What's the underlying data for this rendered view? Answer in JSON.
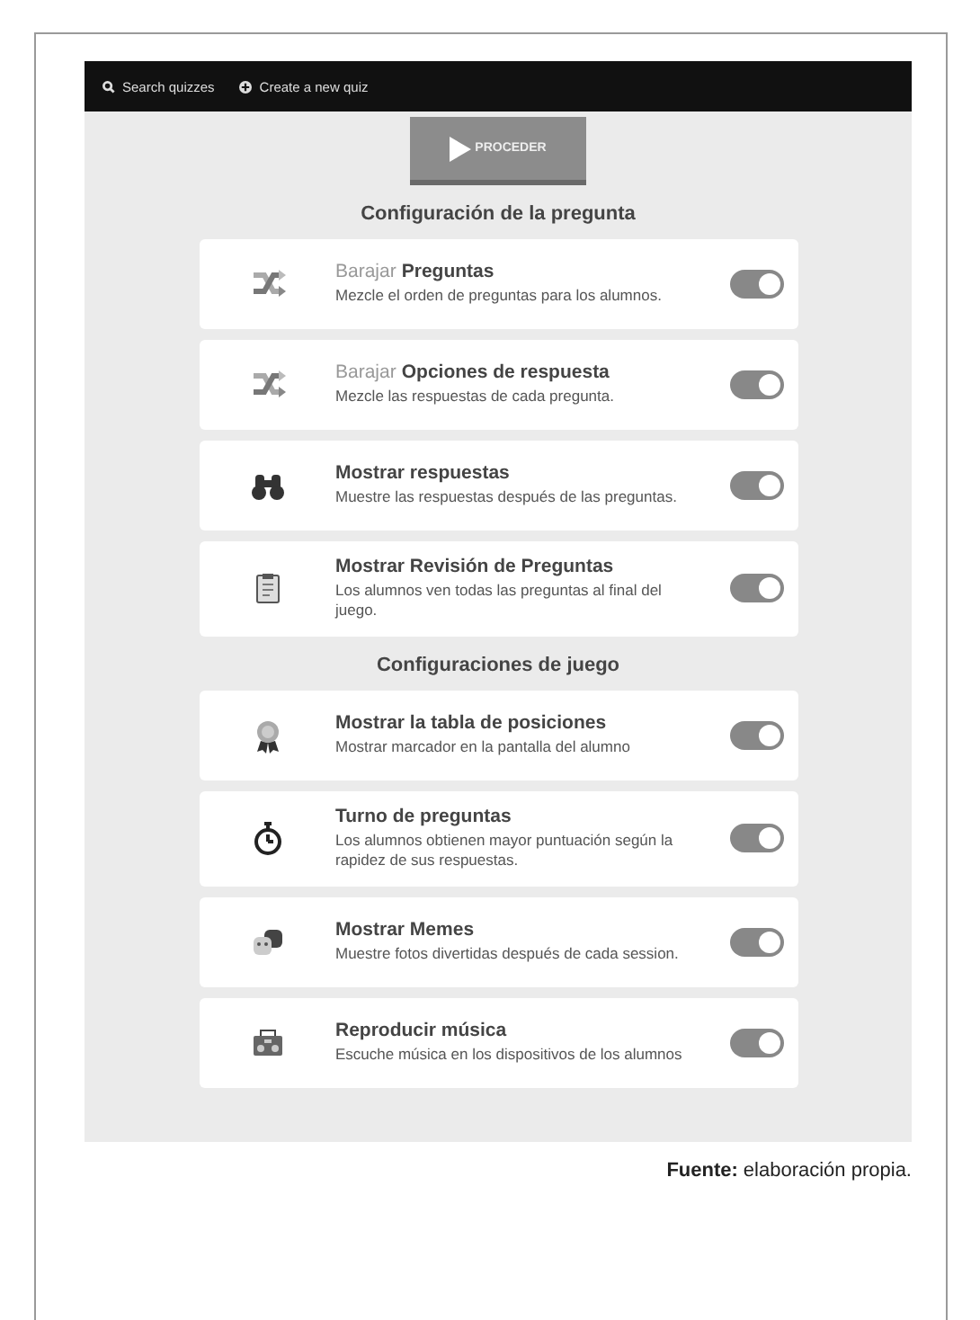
{
  "navbar": {
    "items": [
      "Search quizzes",
      "Create a new quiz"
    ]
  },
  "proceed_button": {
    "label": "PROCEDER"
  },
  "sections": [
    {
      "title": "Configuración de la pregunta",
      "settings": [
        {
          "prefix": "Barajar",
          "title": "Preguntas",
          "description": "Mezcle el orden de preguntas para los alumnos.",
          "on": true
        },
        {
          "prefix": "Barajar",
          "title": "Opciones de respuesta",
          "description": "Mezcle las respuestas de cada pregunta.",
          "on": true
        },
        {
          "title": "Mostrar respuestas",
          "description": "Muestre las respuestas después de las preguntas.",
          "on": true
        },
        {
          "title": "Mostrar Revisión de Preguntas",
          "description": "Los alumnos ven todas las preguntas al final del juego.",
          "on": true
        }
      ]
    },
    {
      "title": "Configuraciones de juego",
      "settings": [
        {
          "title": "Mostrar la tabla de posiciones",
          "description": "Mostrar marcador en la pantalla del alumno",
          "on": true
        },
        {
          "title": "Turno de preguntas",
          "description": "Los alumnos obtienen mayor puntuación según la rapidez de sus respuestas.",
          "on": true
        },
        {
          "title": "Mostrar Memes",
          "description": "Muestre fotos divertidas después de cada session.",
          "on": true
        },
        {
          "title": "Reproducir música",
          "description": "Escuche música en los dispositivos de los alumnos",
          "on": true
        }
      ]
    }
  ],
  "caption": {
    "label": "Fuente:",
    "text": "elaboración propia."
  }
}
